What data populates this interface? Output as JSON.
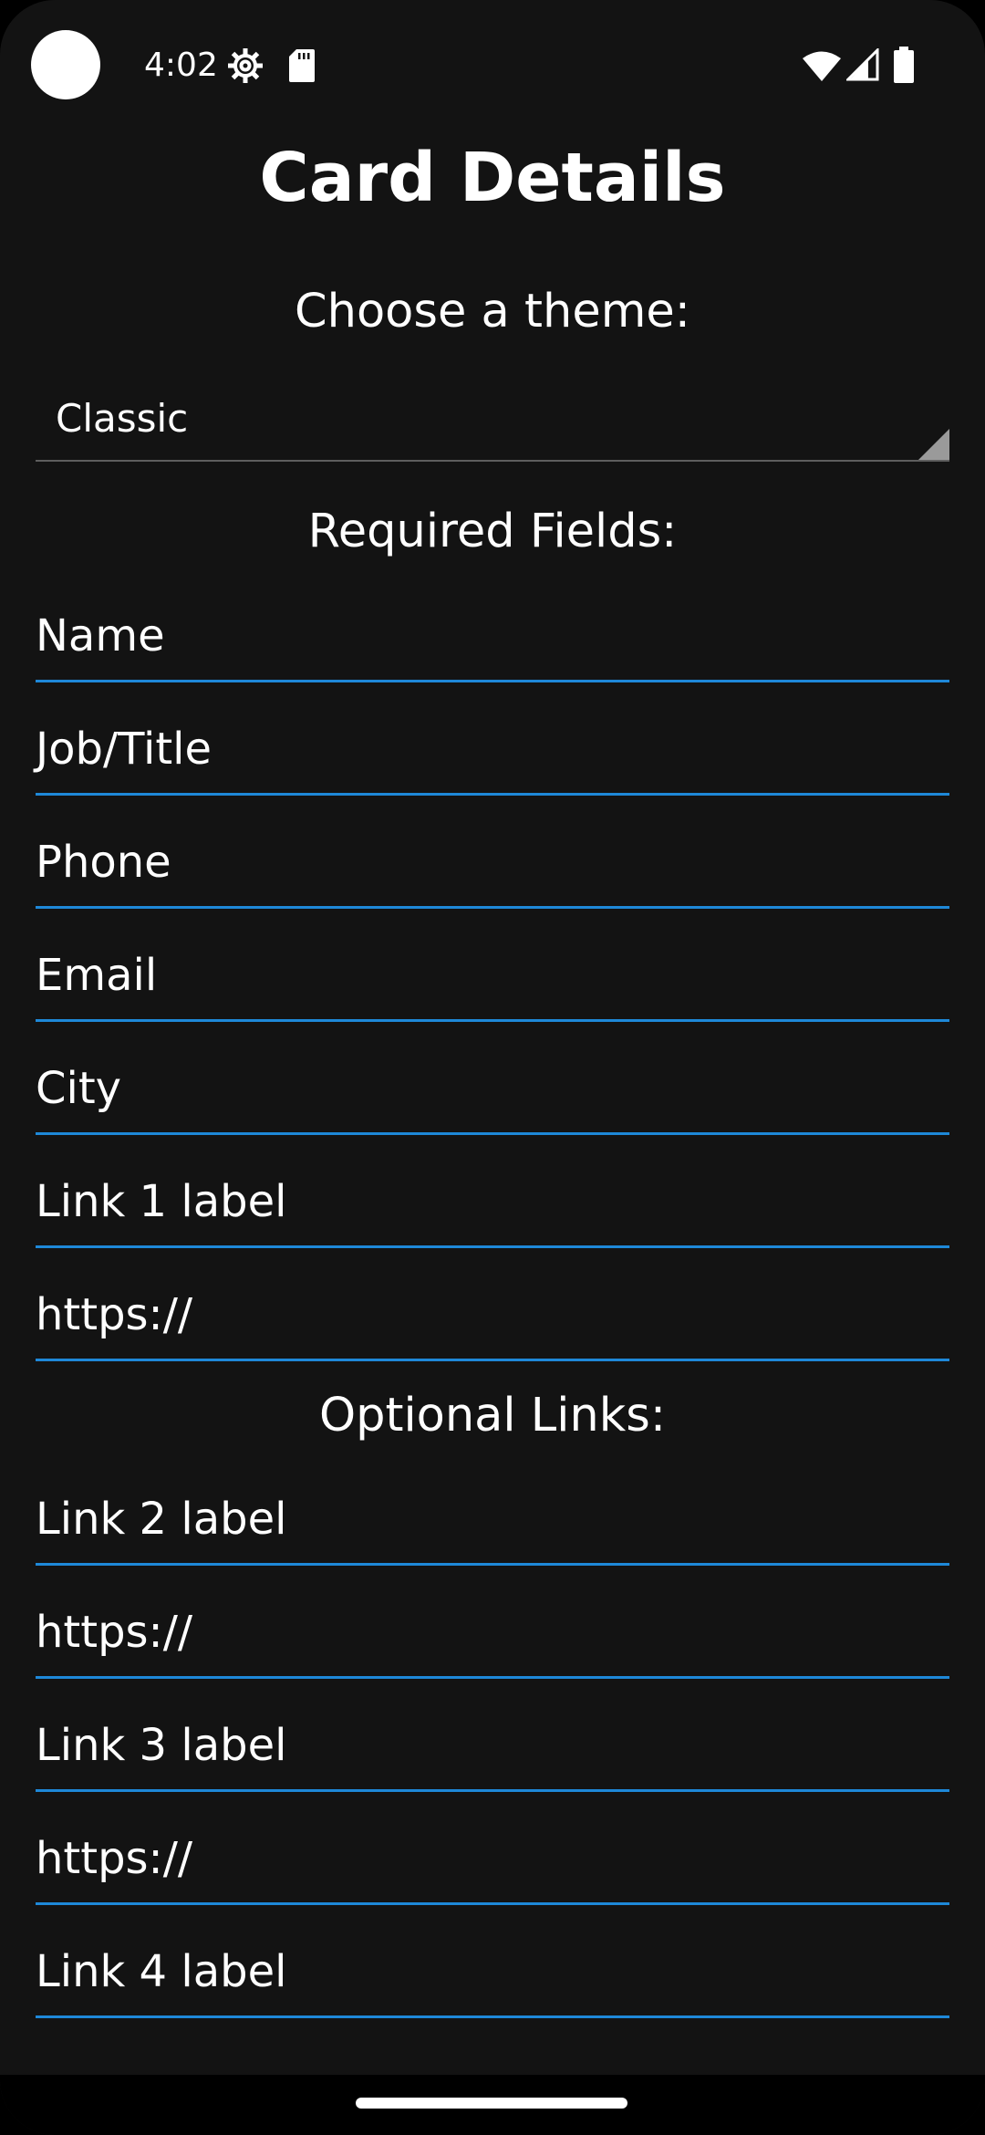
{
  "status_bar": {
    "time": "4:02",
    "icons": [
      "camera-dot",
      "settings-gear-icon",
      "sd-card-icon",
      "wifi-icon",
      "cell-signal-icon",
      "battery-icon"
    ]
  },
  "page": {
    "title": "Card Details"
  },
  "theme": {
    "label": "Choose a theme:",
    "selected": "Classic"
  },
  "required": {
    "label": "Required Fields:",
    "fields": {
      "name": "Name",
      "job_title": "Job/Title",
      "phone": "Phone",
      "email": "Email",
      "city": "City",
      "link1_label": "Link 1 label",
      "link1_url": "https://"
    }
  },
  "optional": {
    "label": "Optional Links:",
    "fields": {
      "link2_label": "Link 2 label",
      "link2_url": "https://",
      "link3_label": "Link 3 label",
      "link3_url": "https://",
      "link4_label": "Link 4 label"
    }
  },
  "colors": {
    "background": "#131313",
    "accent_underline": "#1e88d8",
    "text": "#ffffff"
  }
}
